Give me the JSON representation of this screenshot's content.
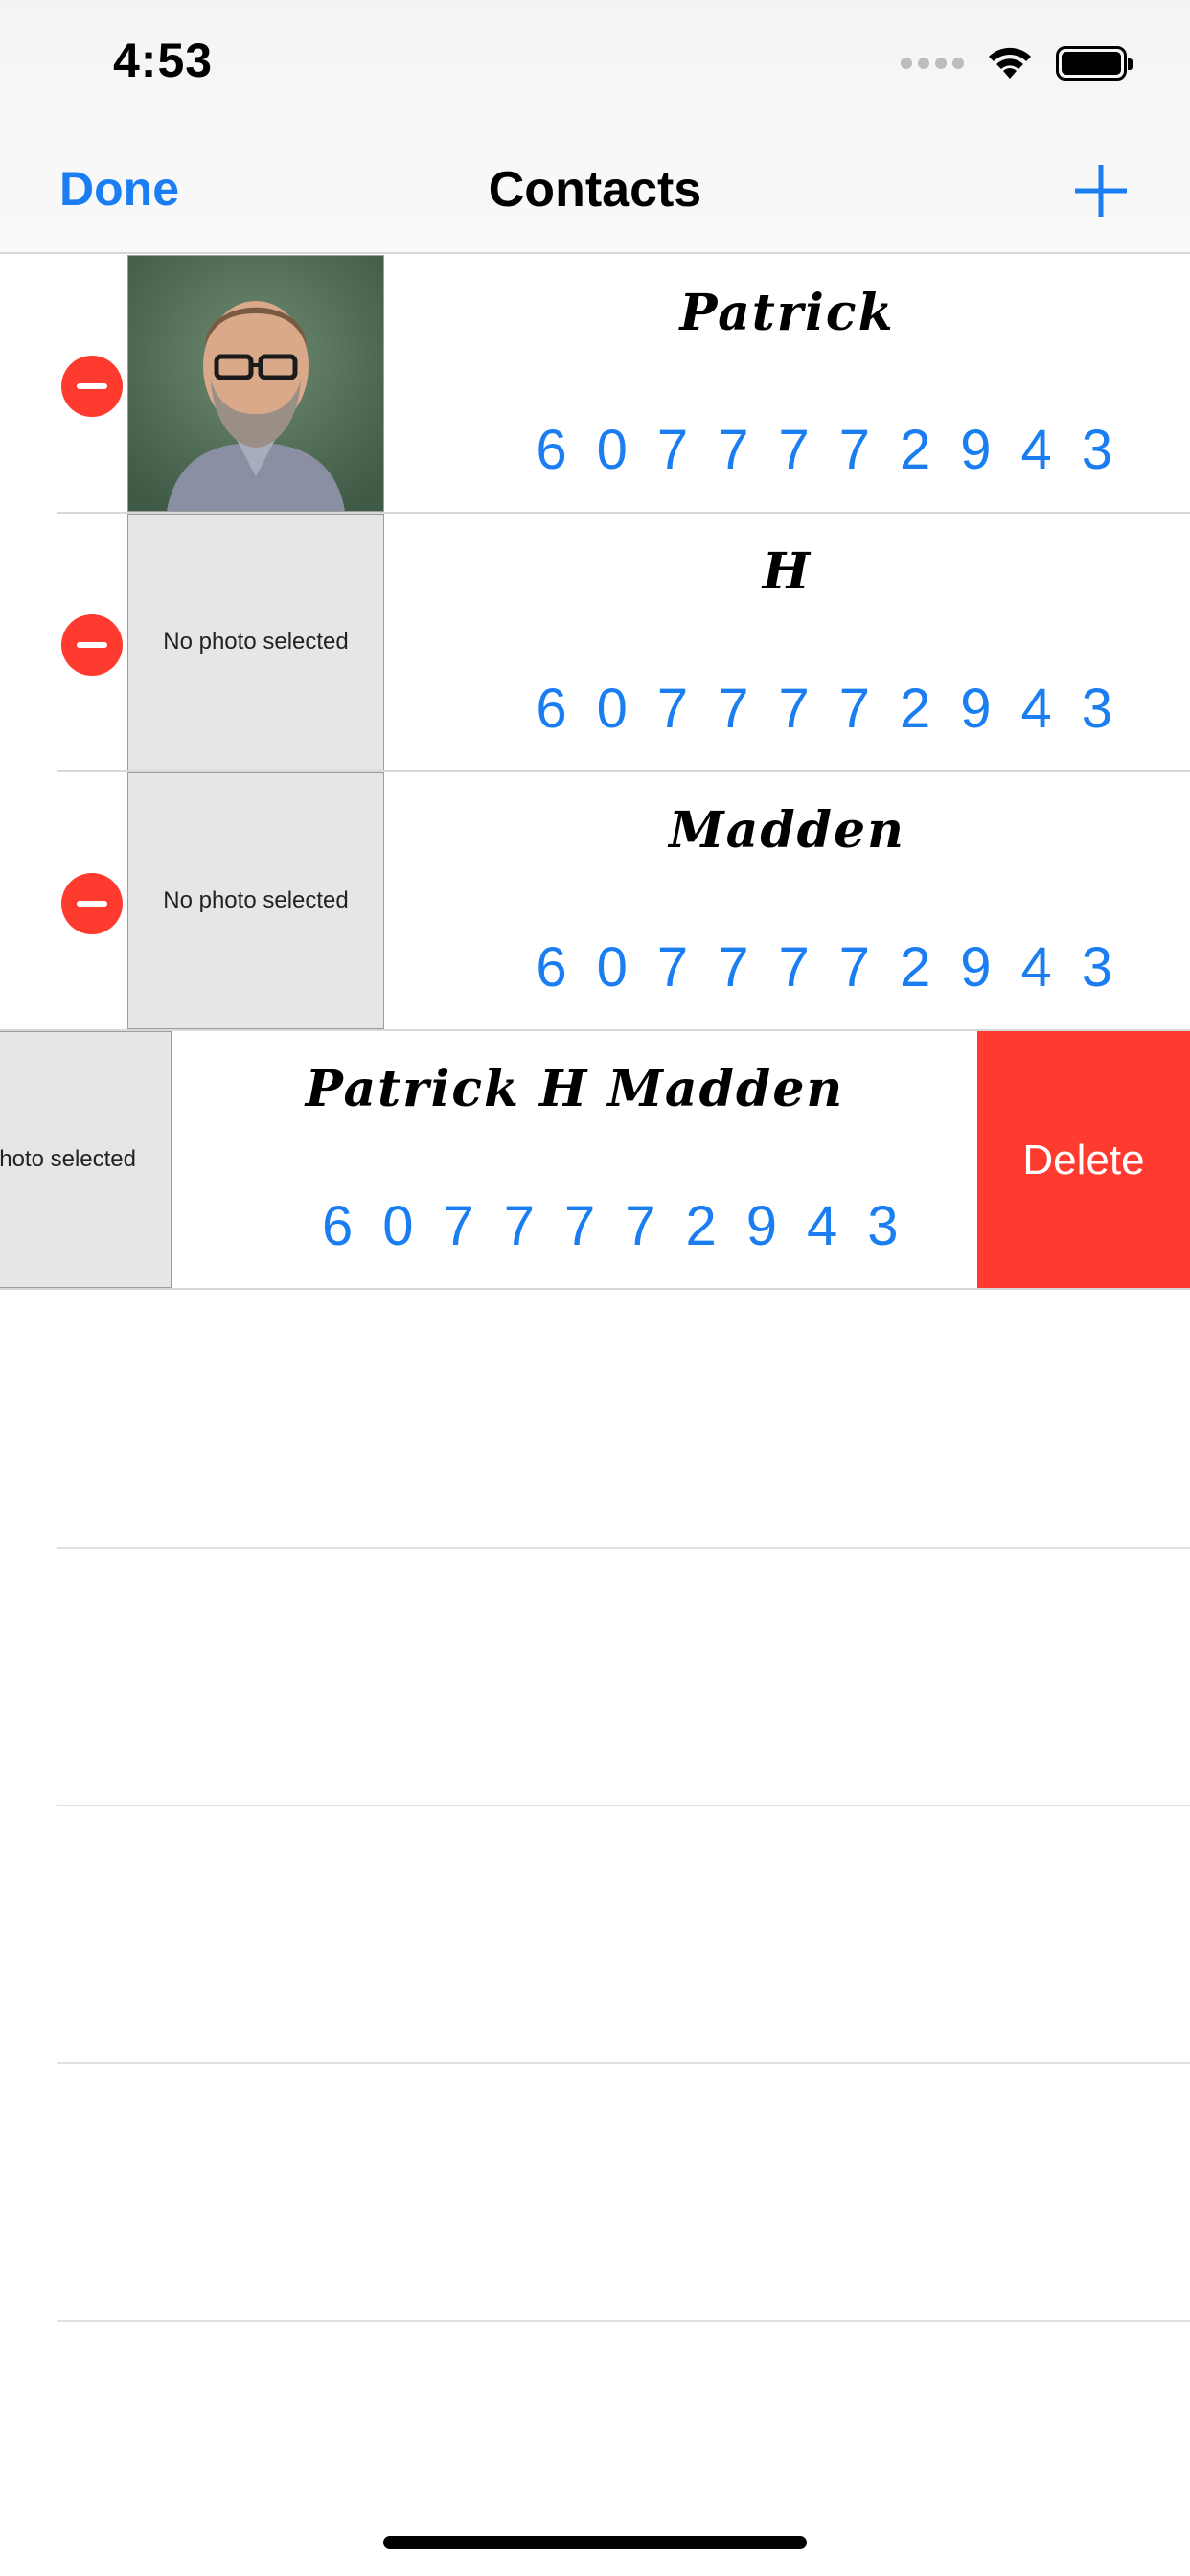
{
  "status_bar": {
    "time": "4:53",
    "icons": [
      "signal-dots-icon",
      "wifi-icon",
      "battery-icon"
    ]
  },
  "nav": {
    "done_label": "Done",
    "title": "Contacts",
    "add_icon": "plus-icon"
  },
  "contacts": [
    {
      "name": "Patrick",
      "phone": "6077772943",
      "has_photo": true
    },
    {
      "name": "H",
      "phone": "6077772943",
      "has_photo": false,
      "photo_placeholder": "No photo selected"
    },
    {
      "name": "Madden",
      "phone": "6077772943",
      "has_photo": false,
      "photo_placeholder": "No photo selected"
    },
    {
      "name": "Patrick H Madden",
      "phone": "6077772943",
      "has_photo": false,
      "photo_placeholder": "photo selected",
      "swiped": true
    }
  ],
  "swipe_action": {
    "delete_label": "Delete"
  },
  "colors": {
    "accent": "#1a7ef2",
    "destructive": "#ff3b30",
    "placeholder_bg": "#e5e6e5"
  }
}
